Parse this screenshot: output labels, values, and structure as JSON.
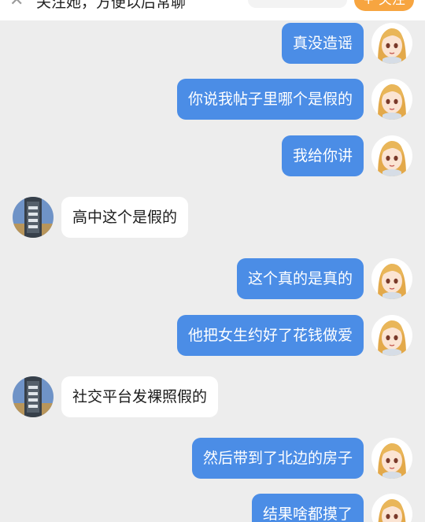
{
  "header": {
    "close_glyph": "✕",
    "hint": "关注她，方便以后常聊",
    "follow_label": "+ 关注"
  },
  "messages": [
    {
      "side": "me",
      "text": "真没造谣"
    },
    {
      "side": "me",
      "text": "你说我帖子里哪个是假的"
    },
    {
      "side": "me",
      "text": "我给你讲"
    },
    {
      "side": "other",
      "text": "高中这个是假的"
    },
    {
      "side": "me",
      "text": "这个真的是真的"
    },
    {
      "side": "me",
      "text": "他把女生约好了花钱做爱"
    },
    {
      "side": "other",
      "text": "社交平台发裸照假的"
    },
    {
      "side": "me",
      "text": "然后带到了北边的房子"
    },
    {
      "side": "me",
      "text": "结果啥都摸了"
    }
  ],
  "colors": {
    "background": "#ededed",
    "my_bubble": "#4b8de6",
    "other_bubble": "#ffffff",
    "follow_button": "#f7a540"
  },
  "icons": {
    "my_avatar": "anime-girl-avatar",
    "other_avatar": "street-sign-avatar"
  }
}
